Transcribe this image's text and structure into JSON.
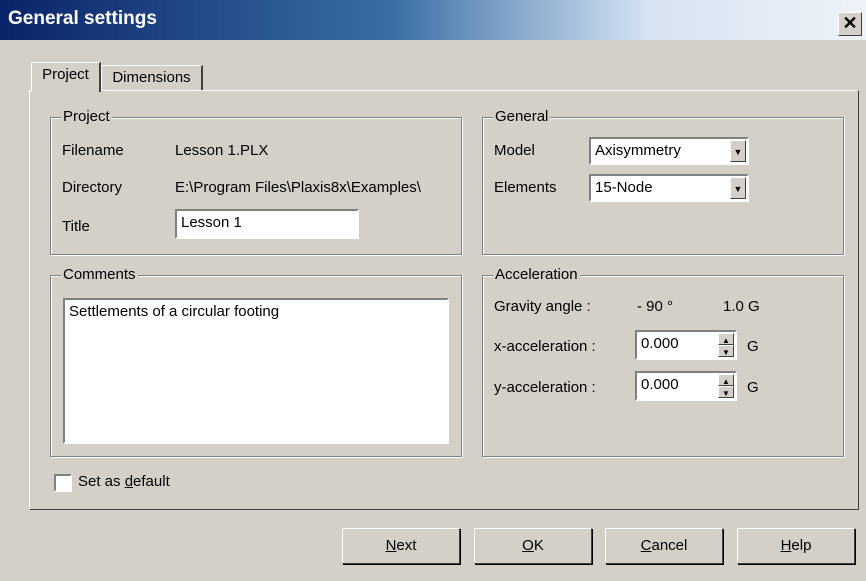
{
  "window": {
    "title": "General settings",
    "close_glyph": "✕"
  },
  "tabs": [
    {
      "label": "Project",
      "active": true
    },
    {
      "label": "Dimensions",
      "active": false
    }
  ],
  "project_group": {
    "legend": "Project",
    "filename_label": "Filename",
    "filename_value": "Lesson 1.PLX",
    "directory_label": "Directory",
    "directory_value": "E:\\Program Files\\Plaxis8x\\Examples\\",
    "title_label": "Title",
    "title_value": "Lesson 1"
  },
  "general_group": {
    "legend": "General",
    "model_label": "Model",
    "model_value": "Axisymmetry",
    "elements_label": "Elements",
    "elements_value": "15-Node"
  },
  "comments_group": {
    "legend": "Comments",
    "text": "Settlements of a circular footing"
  },
  "acceleration_group": {
    "legend": "Acceleration",
    "gravity_label": "Gravity angle :",
    "gravity_value": "- 90 °",
    "gravity_g": "1.0 G",
    "x_label": "x-acceleration :",
    "x_value": "0.000",
    "x_unit": "G",
    "y_label": "y-acceleration :",
    "y_value": "0.000",
    "y_unit": "G"
  },
  "default_checkbox": {
    "label_pre": "Set as ",
    "label_access": "d",
    "label_post": "efault",
    "checked": false
  },
  "buttons": {
    "next": {
      "access": "N",
      "rest": "ext"
    },
    "ok": {
      "access": "O",
      "rest": "K"
    },
    "cancel": {
      "access": "C",
      "rest": "ancel"
    },
    "help": {
      "access": "H",
      "rest": "elp"
    }
  },
  "icons": [
    "close-icon",
    "dropdown-arrow-icon",
    "spin-up-icon",
    "spin-down-icon"
  ]
}
